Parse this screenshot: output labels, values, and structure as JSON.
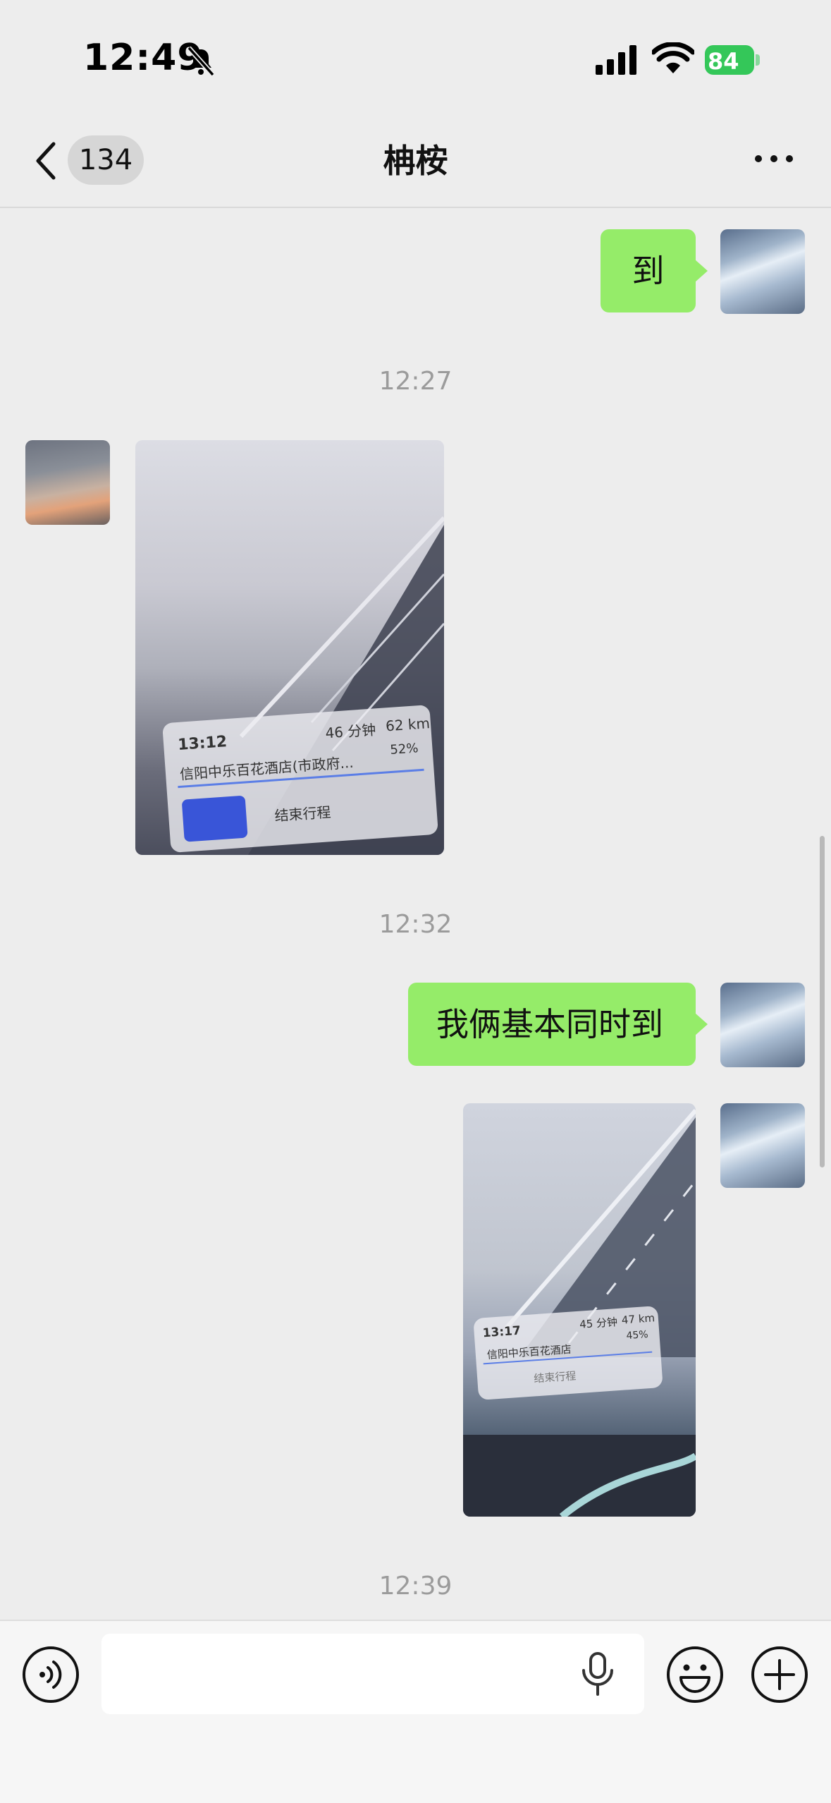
{
  "status_bar": {
    "time": "12:49",
    "battery": "84"
  },
  "nav": {
    "unread_count": "134",
    "title": "柟桉"
  },
  "messages": {
    "msg1_text": "到",
    "time1": "12:27",
    "photo1": {
      "eta": "13:12",
      "duration": "46 分钟",
      "distance": "62 km",
      "destination": "信阳中乐百花酒店(市政府...",
      "battery": "52%",
      "end_trip": "结束行程"
    },
    "time2": "12:32",
    "msg2_text": "我俩基本同时到",
    "photo2": {
      "eta": "13:17",
      "duration": "45 分钟",
      "distance": "47 km",
      "destination": "信阳中乐百花酒店",
      "battery": "45%",
      "end_trip": "结束行程"
    },
    "time3": "12:39"
  },
  "input": {
    "placeholder": ""
  }
}
